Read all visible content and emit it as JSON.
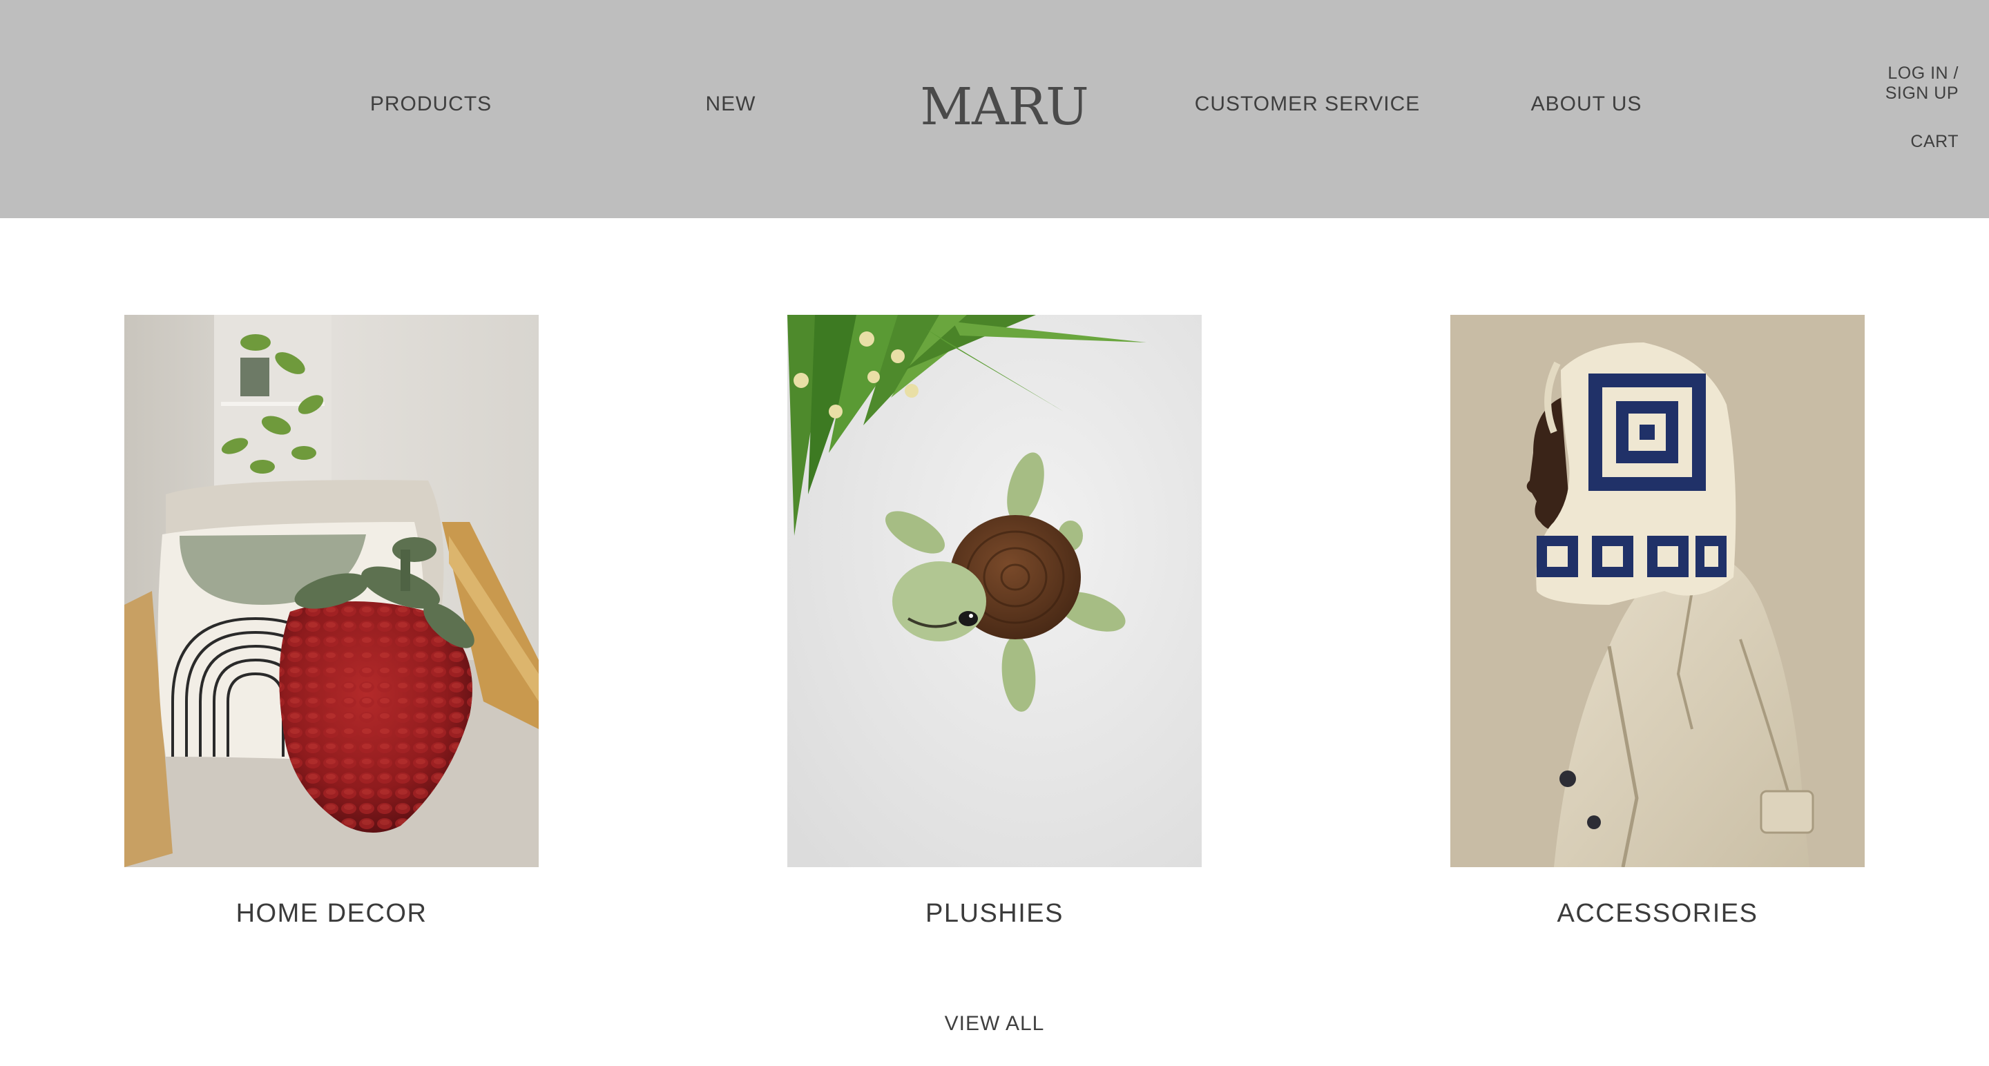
{
  "header": {
    "nav_left": [
      {
        "label": "PRODUCTS"
      },
      {
        "label": "NEW"
      }
    ],
    "brand": "MARU",
    "nav_right": [
      {
        "label": "CUSTOMER SERVICE"
      },
      {
        "label": "ABOUT US"
      }
    ],
    "account": {
      "login_line1": "LOG IN /",
      "login_line2": "SIGN UP",
      "cart": "CART"
    },
    "background_color": "#bebebe"
  },
  "categories": [
    {
      "label": "HOME DECOR",
      "image": "red crochet strawberry pillow on armchair"
    },
    {
      "label": "PLUSHIES",
      "image": "green crochet turtle plush with brown shell"
    },
    {
      "label": "ACCESSORIES",
      "image": "navy and cream granny-square crochet hood"
    }
  ],
  "view_all": "VIEW ALL"
}
